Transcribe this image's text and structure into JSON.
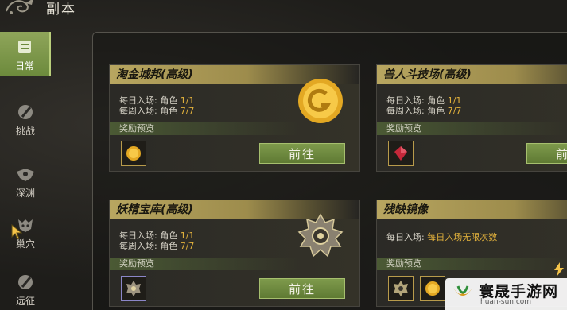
{
  "header": {
    "title": "副本"
  },
  "sidebar": {
    "items": [
      {
        "label": "日常",
        "icon": "scroll-icon",
        "active": true
      },
      {
        "label": "挑战",
        "icon": "sword-shield-icon"
      },
      {
        "label": "深渊",
        "icon": "eye-wings-icon"
      },
      {
        "label": "巢穴",
        "icon": "beast-skull-icon"
      },
      {
        "label": "远征",
        "icon": "sword-shield-icon"
      }
    ]
  },
  "cards": [
    {
      "title": "淘金城邦(高级)",
      "daily_label": "每日入场: 角色",
      "daily_value": "1/1",
      "weekly_label": "每周入场: 角色",
      "weekly_value": "7/7",
      "reward_label": "奖励预览",
      "rewards": [
        "coin-icon"
      ],
      "button_label": "前往"
    },
    {
      "title": "兽人斗技场(高级)",
      "daily_label": "每日入场: 角色",
      "daily_value": "1/1",
      "weekly_label": "每周入场: 角色",
      "weekly_value": "7/7",
      "reward_label": "奖励预览",
      "rewards": [
        "red-crystal-icon"
      ],
      "button_label": "前往"
    },
    {
      "title": "妖精宝库(高级)",
      "daily_label": "每日入场: 角色",
      "daily_value": "1/1",
      "weekly_label": "每周入场: 角色",
      "weekly_value": "7/7",
      "reward_label": "奖励预览",
      "rewards": [
        "emblem-icon"
      ],
      "button_label": "前往"
    },
    {
      "title": "残缺镜像",
      "daily_label": "每日入场:",
      "daily_value": "每日入场无限次数",
      "reward_label": "奖励预览",
      "rewards": [
        "emblem-icon",
        "coin-icon"
      ]
    }
  ],
  "watermark": {
    "text": "寰晟手游网",
    "url": "huan-sun.com"
  },
  "colors": {
    "accent_gold": "#e3b23c",
    "header_gold": "#b8a660",
    "button_green": "#6c8a3c",
    "panel_bg": "#1e1d1a"
  }
}
